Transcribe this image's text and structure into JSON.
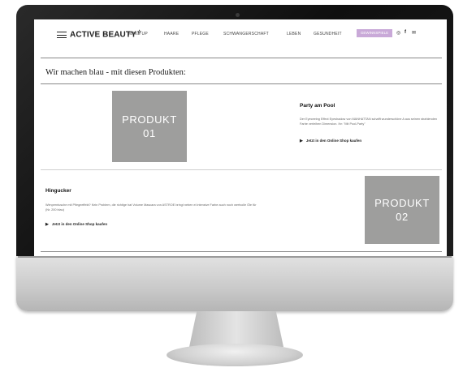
{
  "nav": {
    "brand": "ACTIVE BEAUTY",
    "brand_mark": "☆",
    "items": [
      "MAKE UP",
      "HAARE",
      "PFLEGE",
      "SCHWANGERSCHAFT",
      "LEBEN",
      "GESUNDHEIT"
    ],
    "cta": "GEWINNSPIELE",
    "social": [
      "◎",
      "f",
      "✉"
    ]
  },
  "section_title": "Wir machen blau - mit diesen Produkten:",
  "products": [
    {
      "placeholder_line1": "PRODUKT",
      "placeholder_line2": "01",
      "headline": "Party am Pool",
      "body": "Der Eyeceeing Effect Eyeshadow von MANHATTAN schafft wunderschöne A aus seinen strahlenden Farbe verleihen Dimension. Ihr: \"Mit Pool-Party\"",
      "link": "Jetzt in den Online Shop kaufen"
    },
    {
      "placeholder_line1": "PRODUKT",
      "placeholder_line2": "02",
      "headline": "Hingucker",
      "body": "Wimperntusche mit Pfiegeeffekt? Kein Problem, die richtige hat Volume Mascara von ASTROE bringt neben ei intensive Farbe auch noch wertvolle Öle für (Nr. 200 blau)",
      "link": "Jetzt in den Online Shop kaufen"
    }
  ],
  "colors": {
    "cta_bg": "#c9a9d8",
    "placeholder_bg": "#9e9e9d",
    "bezel": "#151515"
  }
}
